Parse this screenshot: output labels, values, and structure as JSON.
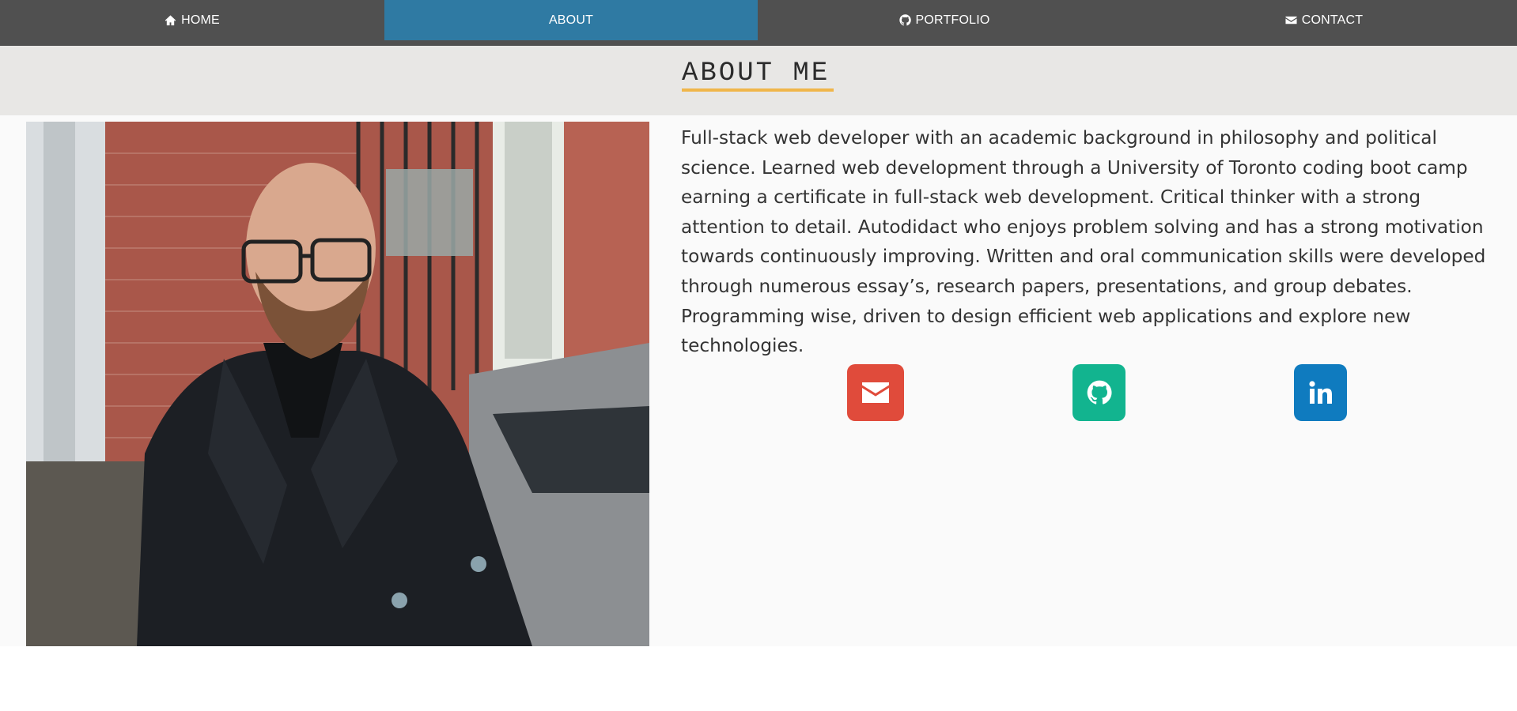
{
  "nav": {
    "items": [
      {
        "label": "HOME",
        "icon": "home-icon"
      },
      {
        "label": "ABOUT",
        "icon": ""
      },
      {
        "label": "PORTFOLIO",
        "icon": "github-icon"
      },
      {
        "label": "CONTACT",
        "icon": "envelope-icon"
      }
    ],
    "active_index": 1
  },
  "header": {
    "title": "ABOUT ME"
  },
  "about": {
    "bio": "Full-stack web developer with an academic background in philosophy and political science. Learned web development through a University of Toronto coding boot camp earning a certificate in full-stack web development. Critical thinker with a strong attention to detail. Autodidact who enjoys problem solving and has a strong motivation towards continuously improving. Written and oral communication skills were developed through numerous essay’s, research papers, presentations, and group debates. Programming wise, driven to design efficient web applications and explore new technologies."
  },
  "social": {
    "links": [
      {
        "name": "email",
        "icon": "envelope-icon",
        "color": "#e04b3b"
      },
      {
        "name": "github",
        "icon": "github-icon",
        "color": "#12b48f"
      },
      {
        "name": "linkedin",
        "icon": "linkedin-icon",
        "color": "#0f7bbf"
      }
    ]
  },
  "colors": {
    "nav_bg": "#505050",
    "nav_active": "#2f7aa3",
    "header_band": "#e8e7e5",
    "title_underline": "#f0b64a",
    "content_bg": "#fafafa"
  }
}
